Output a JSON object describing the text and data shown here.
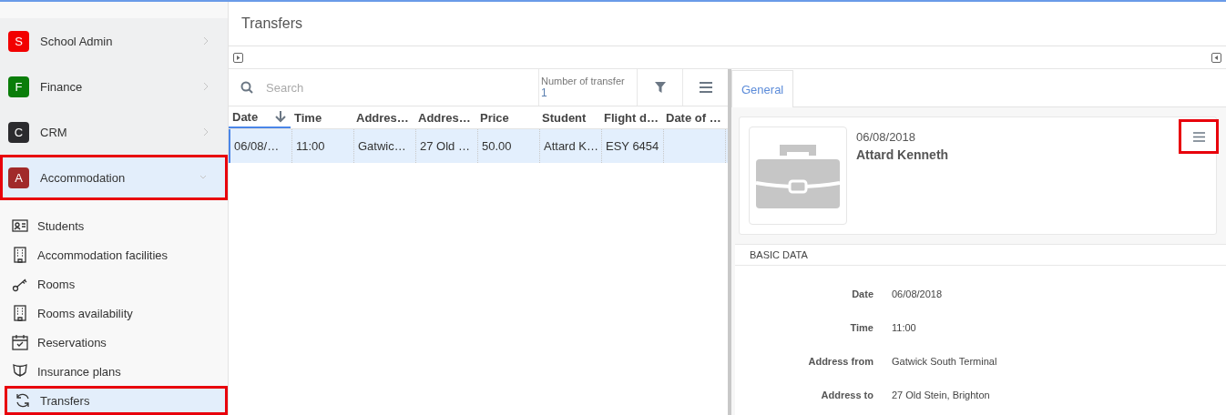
{
  "modules": [
    {
      "letter": "S",
      "label": "School Admin",
      "color": "#f20000",
      "expanded": false,
      "highlighted": false
    },
    {
      "letter": "F",
      "label": "Finance",
      "color": "#0a7d0a",
      "expanded": false,
      "highlighted": false
    },
    {
      "letter": "C",
      "label": "CRM",
      "color": "#2b2b2e",
      "expanded": false,
      "highlighted": false
    },
    {
      "letter": "A",
      "label": "Accommodation",
      "color": "#a12a2a",
      "expanded": true,
      "highlighted": true
    }
  ],
  "sub_items": [
    {
      "kind": "card",
      "label": "Students",
      "selected": false,
      "highlighted": false
    },
    {
      "kind": "building",
      "label": "Accommodation facilities",
      "selected": false,
      "highlighted": false
    },
    {
      "kind": "key",
      "label": "Rooms",
      "selected": false,
      "highlighted": false
    },
    {
      "kind": "building",
      "label": "Rooms availability",
      "selected": false,
      "highlighted": false
    },
    {
      "kind": "calendar",
      "label": "Reservations",
      "selected": false,
      "highlighted": false
    },
    {
      "kind": "shield",
      "label": "Insurance plans",
      "selected": false,
      "highlighted": false
    },
    {
      "kind": "sync",
      "label": "Transfers",
      "selected": true,
      "highlighted": true
    }
  ],
  "page_title": "Transfers",
  "search": {
    "placeholder": "Search"
  },
  "counter": {
    "label": "Number of transfer",
    "value": "1"
  },
  "table": {
    "columns": [
      {
        "label": "Date",
        "sorted": true
      },
      {
        "label": "Time",
        "sorted": false
      },
      {
        "label": "Addres…",
        "sorted": false
      },
      {
        "label": "Addres…",
        "sorted": false
      },
      {
        "label": "Price",
        "sorted": false
      },
      {
        "label": "Student",
        "sorted": false
      },
      {
        "label": "Flight d…",
        "sorted": false
      },
      {
        "label": "Date of …",
        "sorted": false
      }
    ],
    "rows": [
      {
        "selected": true,
        "cells": [
          "06/08/…",
          "11:00",
          "Gatwic…",
          "27 Old …",
          "50.00",
          "Attard K…",
          "ESY 6454",
          ""
        ]
      }
    ]
  },
  "detail": {
    "tabs": [
      {
        "label": "General",
        "selected": true
      }
    ],
    "date": "06/08/2018",
    "name": "Attard Kenneth",
    "menu_highlighted": true,
    "section": "BASIC DATA",
    "fields": [
      {
        "label": "Date",
        "value": "06/08/2018"
      },
      {
        "label": "Time",
        "value": "11:00"
      },
      {
        "label": "Address from",
        "value": "Gatwick South Terminal"
      },
      {
        "label": "Address to",
        "value": "27 Old Stein, Brighton"
      }
    ]
  }
}
